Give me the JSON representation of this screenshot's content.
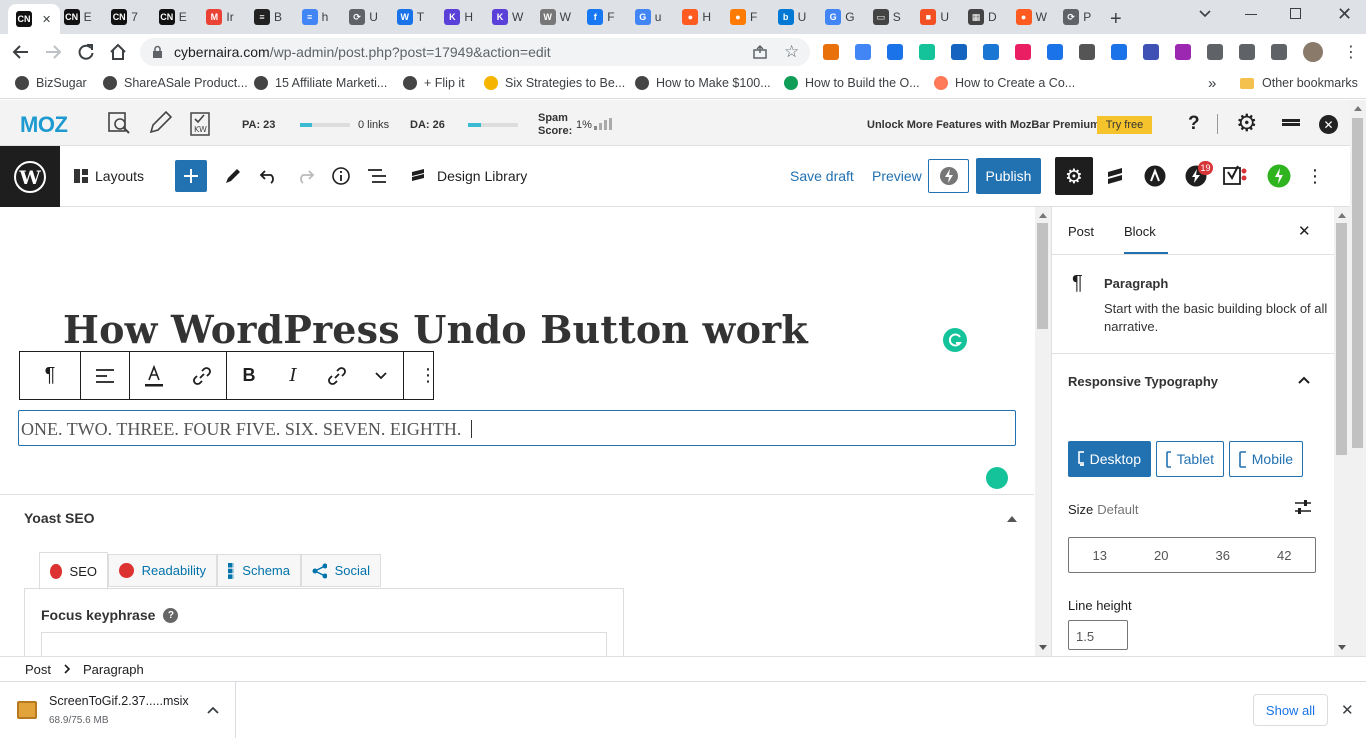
{
  "browser": {
    "tabs": [
      {
        "icon": "CN",
        "label": "",
        "color": "#111"
      },
      {
        "icon": "CN",
        "label": "E",
        "color": "#111"
      },
      {
        "icon": "CN",
        "label": "7",
        "color": "#111"
      },
      {
        "icon": "CN",
        "label": "E",
        "color": "#111"
      },
      {
        "icon": "M",
        "label": "Ir",
        "color": "#ea4335"
      },
      {
        "icon": "≡",
        "label": "B",
        "color": "#222"
      },
      {
        "icon": "≡",
        "label": "h",
        "color": "#4285f4"
      },
      {
        "icon": "⟳",
        "label": "U",
        "color": "#5f6368"
      },
      {
        "icon": "W",
        "label": "T",
        "color": "#1a73e8"
      },
      {
        "icon": "K",
        "label": "H",
        "color": "#5b3fd9"
      },
      {
        "icon": "K",
        "label": "W",
        "color": "#5b3fd9"
      },
      {
        "icon": "W",
        "label": "W",
        "color": "#777"
      },
      {
        "icon": "f",
        "label": "F",
        "color": "#1877f2"
      },
      {
        "icon": "G",
        "label": "u",
        "color": "#4285f4"
      },
      {
        "icon": "●",
        "label": "H",
        "color": "#ff5a1f"
      },
      {
        "icon": "●",
        "label": "F",
        "color": "#ff7a00"
      },
      {
        "icon": "b",
        "label": "U",
        "color": "#0078d4"
      },
      {
        "icon": "G",
        "label": "G",
        "color": "#4285f4"
      },
      {
        "icon": "▭",
        "label": "S",
        "color": "#444"
      },
      {
        "icon": "■",
        "label": "U",
        "color": "#f25022"
      },
      {
        "icon": "▦",
        "label": "D",
        "color": "#444"
      },
      {
        "icon": "●",
        "label": "W",
        "color": "#ff5a1f"
      },
      {
        "icon": "⟳",
        "label": "P",
        "color": "#5f6368"
      }
    ],
    "url_host": "cybernaira.com",
    "url_path": "/wp-admin/post.php?post=17949&action=edit",
    "bookmarks": [
      {
        "label": "BizSugar",
        "color": "#444"
      },
      {
        "label": "ShareASale Product...",
        "color": "#444"
      },
      {
        "label": "15 Affiliate Marketi...",
        "color": "#444"
      },
      {
        "label": "+ Flip it",
        "color": "#444"
      },
      {
        "label": "Six Strategies to Be...",
        "color": "#f4b400"
      },
      {
        "label": "How to Make $100...",
        "color": "#444"
      },
      {
        "label": "How to Build the O...",
        "color": "#0f9d58"
      },
      {
        "label": "How to Create a Co...",
        "color": "#ff7a59"
      }
    ],
    "bookmarks_more": "»",
    "other_bookmarks": "Other bookmarks"
  },
  "moz": {
    "logo": "MOZ",
    "pa": "PA: 23",
    "links": "0 links",
    "da": "DA: 26",
    "spam_label_1": "Spam",
    "spam_label_2": "Score:",
    "spam_value": "1%",
    "promo": "Unlock More Features with MozBar Premium",
    "try_free": "Try free"
  },
  "wp": {
    "layouts": "Layouts",
    "design_library": "Design Library",
    "save_draft": "Save draft",
    "preview": "Preview",
    "publish": "Publish",
    "notification_count": "19",
    "title": "How WordPress Undo Button work",
    "paragraph": "ONE. TWO. THREE. FOUR FIVE. SIX. SEVEN. EIGHTH.",
    "yoast": {
      "title": "Yoast SEO",
      "tabs": [
        "SEO",
        "Readability",
        "Schema",
        "Social"
      ],
      "focus_keyphrase": "Focus keyphrase"
    },
    "sidebar": {
      "tab_post": "Post",
      "tab_block": "Block",
      "block_name": "Paragraph",
      "block_desc": "Start with the basic building block of all narrative.",
      "responsive_typography": "Responsive Typography",
      "devices": [
        "Desktop",
        "Tablet",
        "Mobile"
      ],
      "size_label": "Size",
      "size_value": "Default",
      "sizes": [
        "13",
        "20",
        "36",
        "42"
      ],
      "line_height_label": "Line height",
      "line_height_value": "1.5"
    },
    "breadcrumb": [
      "Post",
      "Paragraph"
    ]
  },
  "downloads": {
    "filename": "ScreenToGif.2.37.....msix",
    "progress_text": "68.9/75.6 MB",
    "show_all": "Show all"
  }
}
